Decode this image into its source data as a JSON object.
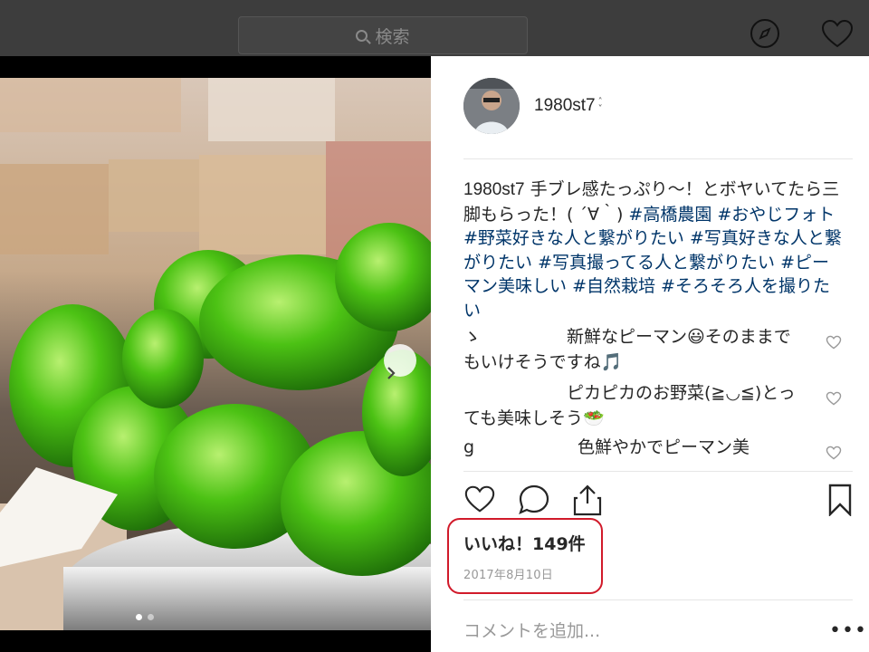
{
  "topbar": {
    "search_placeholder": "検索",
    "explore_icon": "compass-icon",
    "activity_icon": "heart-icon"
  },
  "photo": {
    "next_icon": "chevron-right-icon",
    "carousel_total": 2,
    "carousel_active": 1
  },
  "post": {
    "username": "1980st7",
    "caption_user": "1980st7",
    "caption_text": " 手ブレ感たっぷり〜！とボヤいてたら三脚もらった！( ´∀｀) ",
    "tags": [
      "#高橋農園",
      "#おやじフォト",
      "#野菜好きな人と繋がりたい",
      "#写真好きな人と繋がりたい",
      "#写真撮ってる人と繋がりたい",
      "#ピーマン美味しい",
      "#自然栽培",
      "#そろそろ人を撮りたい"
    ],
    "comments": [
      {
        "text": "ゝ　　　　　新鮮なピーマン😃そのままでもいけそうですね🎵"
      },
      {
        "text": "　　　　　　ピカピカのお野菜(≧◡≦)とっても美味しそう🥗"
      },
      {
        "text": "g　　　　　　色鮮やかでピーマン美"
      }
    ],
    "likes": "いいね！149件",
    "date": "2017年8月10日",
    "comment_placeholder": "コメントを追加...",
    "more_label": "•••"
  },
  "colors": {
    "link": "#003569",
    "highlight": "#d11a2a",
    "topbar": "#3d3d3d"
  }
}
